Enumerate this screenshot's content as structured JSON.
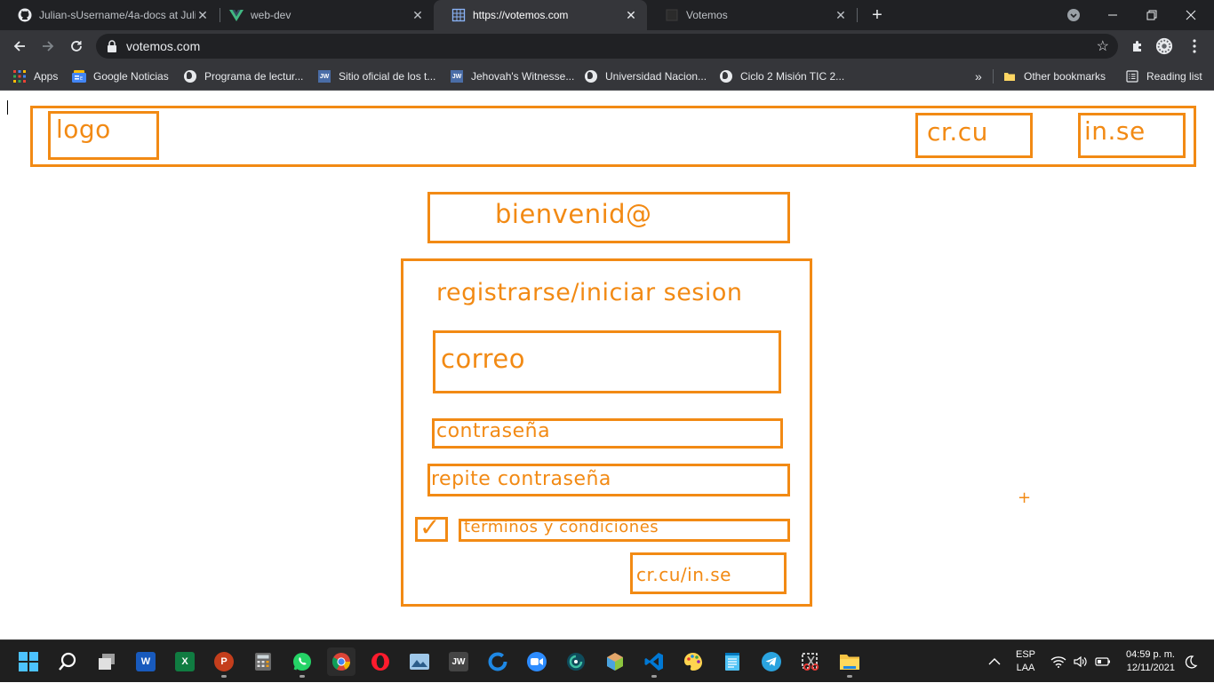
{
  "browser": {
    "tabs": [
      {
        "title": "Julian-sUsername/4a-docs at Juli",
        "icon": "github-icon",
        "active": false
      },
      {
        "title": "web-dev",
        "icon": "vue-icon",
        "active": false
      },
      {
        "title": "https://votemos.com",
        "icon": "grid-icon",
        "active": true
      },
      {
        "title": "Votemos",
        "icon": "page-icon",
        "active": false
      }
    ],
    "address": "votemos.com",
    "bookmarks": [
      {
        "label": "Apps",
        "icon": "apps-grid-icon"
      },
      {
        "label": "Google Noticias",
        "icon": "google-news-icon"
      },
      {
        "label": "Programa de lectur...",
        "icon": "globe-icon"
      },
      {
        "label": "Sitio oficial de los t...",
        "icon": "jw-icon"
      },
      {
        "label": "Jehovah's Witnesse...",
        "icon": "jw-icon"
      },
      {
        "label": "Universidad Nacion...",
        "icon": "globe-icon"
      },
      {
        "label": "Ciclo 2 Misión TIC 2...",
        "icon": "globe-icon"
      }
    ],
    "overflow": "»",
    "other_bookmarks": "Other bookmarks",
    "reading_list": "Reading list",
    "jw_badge": "JW"
  },
  "wireframe": {
    "header": {
      "logo": "logo",
      "register_link": "cr.cu",
      "login_link": "in.se"
    },
    "welcome": "bienvenid@",
    "form": {
      "title": "registrarse/iniciar sesion",
      "email": "correo",
      "password": "contraseña",
      "repeat_password": "repite contraseña",
      "checkbox_mark": "✓",
      "terms": "terminos y condiciones",
      "submit": "cr.cu/in.se"
    },
    "cursor": "+"
  },
  "taskbar": {
    "apps": [
      "start",
      "search",
      "task-view",
      "word",
      "excel",
      "powerpoint",
      "calculator",
      "whatsapp",
      "chrome",
      "opera",
      "photos",
      "jw-library",
      "unknown-blue",
      "zoom",
      "camtasia",
      "box-app",
      "vscode",
      "paint",
      "notepad",
      "telegram",
      "snipping-tool",
      "file-explorer"
    ],
    "word_glyph": "W",
    "excel_glyph": "X",
    "ppt_glyph": "P",
    "jw_glyph": "JW",
    "lang_top": "ESP",
    "lang_bottom": "LAA",
    "time": "04:59 p. m.",
    "date": "12/11/2021"
  },
  "colors": {
    "wireframe_orange": "#f28a14",
    "chrome_dark": "#202124",
    "chrome_toolbar": "#35363a"
  }
}
